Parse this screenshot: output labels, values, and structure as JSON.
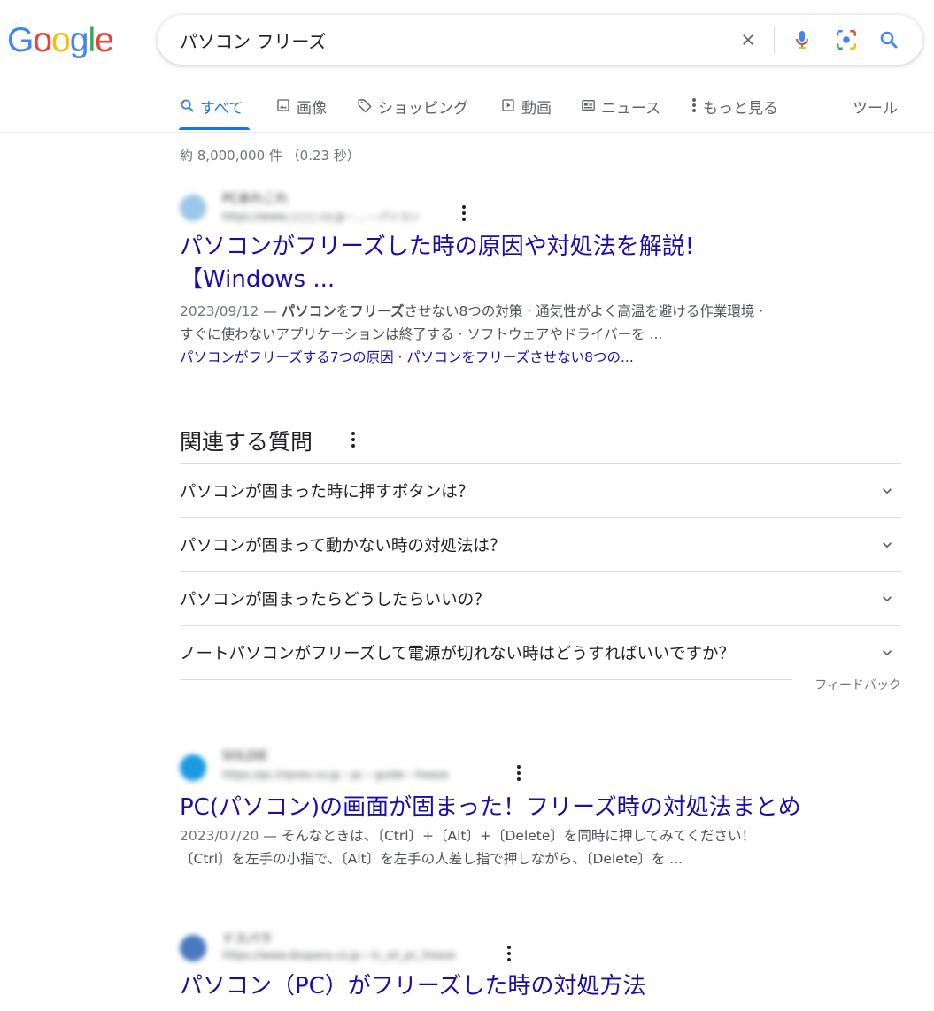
{
  "logo": {
    "letters": [
      "G",
      "o",
      "o",
      "g",
      "l",
      "e"
    ]
  },
  "search": {
    "query": "パソコン フリーズ"
  },
  "tabs": [
    {
      "label": "すべて",
      "icon": "search-icon"
    },
    {
      "label": "画像",
      "icon": "image-icon"
    },
    {
      "label": "ショッピング",
      "icon": "tag-icon"
    },
    {
      "label": "動画",
      "icon": "play-icon"
    },
    {
      "label": "ニュース",
      "icon": "newspaper-icon"
    },
    {
      "label": "もっと見る",
      "icon": "more-vert-icon"
    }
  ],
  "tools_label": "ツール",
  "result_stats": "約 8,000,000 件 （0.23 秒）",
  "results": [
    {
      "site_name": "PCあれこれ",
      "url": "https://www.○○○.co.jp › ... › パソコン",
      "favicon_color": "#9cc7e8",
      "title_line1": "パソコンがフリーズした時の原因や対処法を解説!",
      "title_line2": "【Windows ...",
      "date": "2023/09/12",
      "snippet_parts": [
        "パソコン",
        "を",
        "フリーズ",
        "させない8つの対策 · 通気性がよく高温を避ける作業環境 ·"
      ],
      "snippet_line2": "すぐに使わないアプリケーションは終了する · ソフトウェアやドライバーを ...",
      "sitelink1": "パソコンがフリーズする7つの原因",
      "sitelink_sep": " · ",
      "sitelink2": "パソコンをフリーズさせない8つの..."
    },
    {
      "site_name": "SOLDIE",
      "url": "https://pc.tripreo.co.jp › pc › guide › freeze",
      "favicon_color": "#1a9be0",
      "title": "PC(パソコン)の画面が固まった！フリーズ時の対処法まとめ",
      "date": "2023/07/20",
      "snippet_line1": "そんなときは、〔Ctrl〕+〔Alt〕+〔Delete〕を同時に押してみてください！",
      "snippet_line2": "〔Ctrl〕を左手の小指で、〔Alt〕を左手の人差し指で押しながら、〔Delete〕を ..."
    },
    {
      "site_name": "ドスパラ",
      "url": "https://www.dospara.co.jp › tc_sit_pc_freeze",
      "favicon_color": "#4a79c0",
      "title": "パソコン（PC）がフリーズした時の対処方法"
    }
  ],
  "paa": {
    "title": "関連する質問",
    "questions": [
      "パソコンが固まった時に押すボタンは？",
      "パソコンが固まって動かない時の対処法は？",
      "パソコンが固まったらどうしたらいいの？",
      "ノートパソコンがフリーズして電源が切れない時はどうすればいいですか？"
    ],
    "feedback": "フィードバック"
  },
  "colors": {
    "link": "#1a0dab",
    "accent": "#1a73e8",
    "text": "#202124",
    "muted": "#70757a"
  }
}
